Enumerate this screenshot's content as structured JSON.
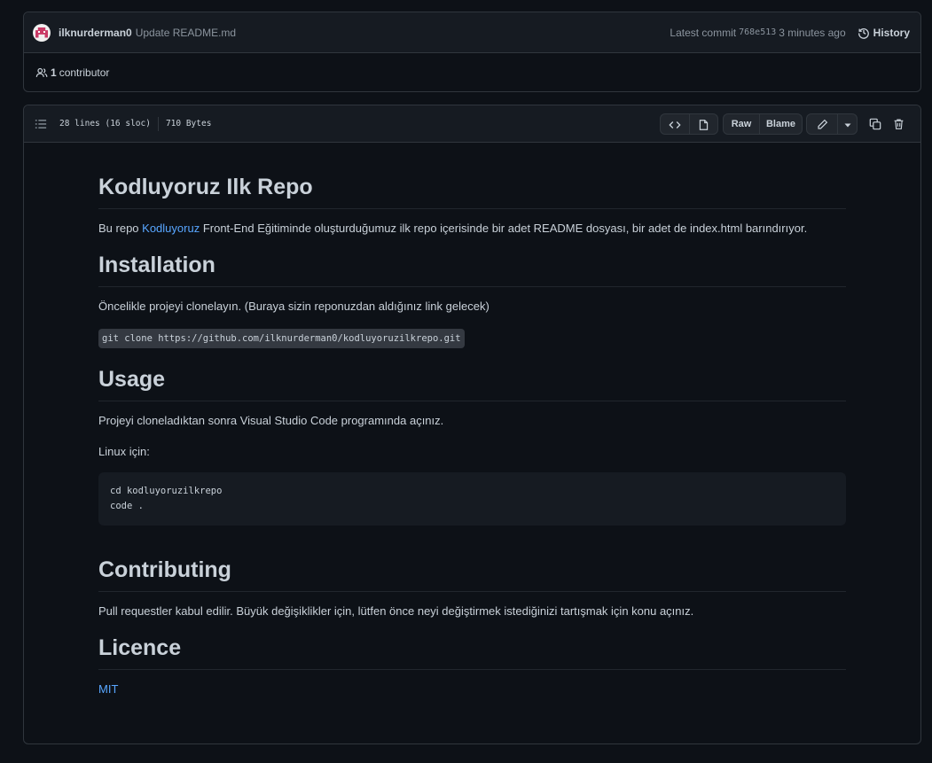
{
  "commit": {
    "author": "ilknurderman0",
    "message": "Update README.md",
    "latest_label": "Latest commit",
    "sha": "768e513",
    "time": "3 minutes ago",
    "history_label": "History"
  },
  "contributors": {
    "count": "1",
    "label": "contributor"
  },
  "file": {
    "lines": "28 lines (16 sloc)",
    "size": "710 Bytes",
    "raw_label": "Raw",
    "blame_label": "Blame"
  },
  "readme": {
    "title": "Kodluyoruz Ilk Repo",
    "intro_prefix": "Bu repo ",
    "intro_link": "Kodluyoruz",
    "intro_suffix": " Front-End Eğitiminde oluşturduğumuz ilk repo içerisinde bir adet README dosyası, bir adet de index.html barındırıyor.",
    "installation_heading": "Installation",
    "installation_text": "Öncelikle projeyi clonelayın. (Buraya sizin reponuzdan aldığınız link gelecek)",
    "clone_command": "git clone https://github.com/ilknurderman0/kodluyoruzilkrepo.git",
    "usage_heading": "Usage",
    "usage_text": "Projeyi cloneladıktan sonra Visual Studio Code programında açınız.",
    "linux_label": "Linux için:",
    "code_block": "cd kodluyoruzilkrepo\ncode .",
    "contributing_heading": "Contributing",
    "contributing_text": "Pull requestler kabul edilir. Büyük değişiklikler için, lütfen önce neyi değiştirmek istediğinizi tartışmak için konu açınız.",
    "licence_heading": "Licence",
    "licence_link": "MIT"
  },
  "colors": {
    "background": "#0d1117",
    "border": "#30363d",
    "link": "#58a6ff",
    "text": "#c9d1d9"
  },
  "icons": [
    "avatar",
    "history-icon",
    "people-icon",
    "list-icon",
    "code-icon",
    "file-icon",
    "pencil-icon",
    "triangle-down-icon",
    "copy-icon",
    "trash-icon"
  ]
}
